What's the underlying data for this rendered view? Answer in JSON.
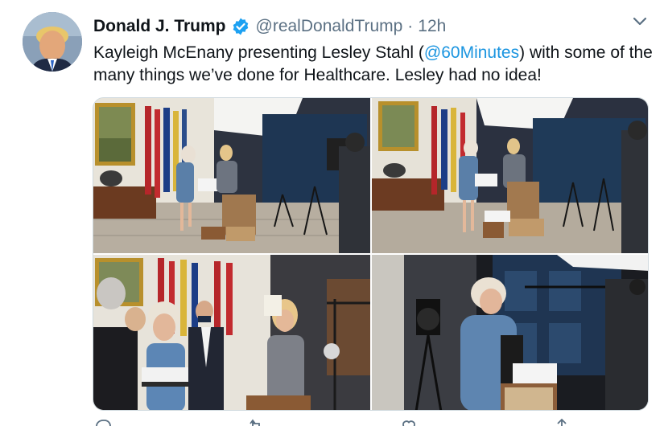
{
  "tweet": {
    "display_name": "Donald J. Trump",
    "verified_icon": "verified-badge-icon",
    "handle": "@realDonaldTrump",
    "separator": "·",
    "timestamp": "12h",
    "text_before": "Kayleigh McEnany presenting Lesley Stahl (",
    "mention": "@60Minutes",
    "text_after": ") with some of the many things we’ve done for Healthcare. Lesley had no idea!",
    "media_count": 4
  },
  "colors": {
    "accent": "#1da1f2",
    "link": "#1b95e0",
    "secondary_text": "#5b7083",
    "border": "#cfd9de"
  },
  "icons": {
    "more": "chevron-down-icon",
    "actions": [
      "reply-icon",
      "retweet-icon",
      "like-icon",
      "share-icon"
    ]
  }
}
